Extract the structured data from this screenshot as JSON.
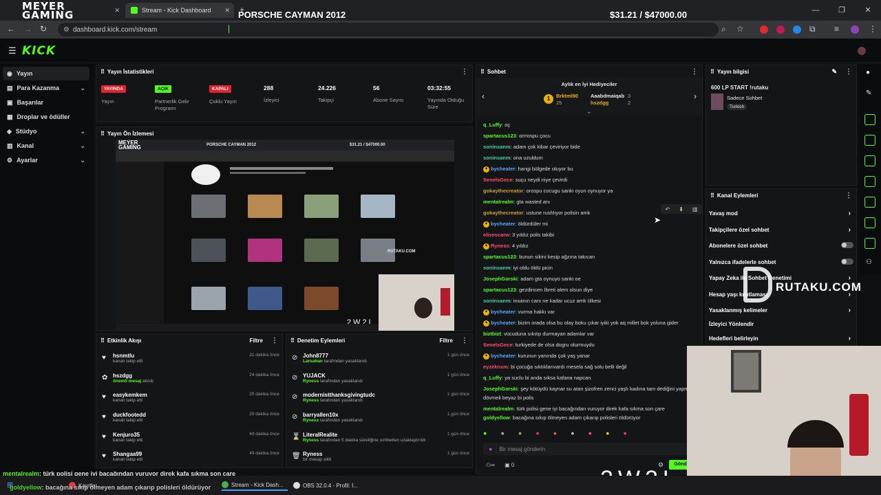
{
  "browser": {
    "tab1_label": "Meyer Gaming",
    "tab2_label": "Stream - Kick Dashboard",
    "url": "dashboard.kick.com/stream",
    "overlay_brand_line1": "MEYER",
    "overlay_brand_line2": "GAMING",
    "overlay_game": "PORSCHE CAYMAN 2012",
    "overlay_money": "$31.21 / $47000.00"
  },
  "kick": {
    "logo": "KICK"
  },
  "sidebar": {
    "items": [
      {
        "label": "Yayın"
      },
      {
        "label": "Para Kazanma"
      },
      {
        "label": "Başarılar"
      },
      {
        "label": "Droplar ve ödüller"
      },
      {
        "label": "Stüdyo"
      },
      {
        "label": "Kanal"
      },
      {
        "label": "Ayarlar"
      }
    ]
  },
  "stats": {
    "title": "Yayın İstatistikleri",
    "items": [
      {
        "badge": "YAYINDA",
        "label": "Yayın",
        "color": "#e5232f"
      },
      {
        "badge": "AÇIK",
        "label": "Partnerlik Gelir Programı",
        "color": "#53fc18"
      },
      {
        "badge": "KAPALI",
        "label": "Çoklu Yayın",
        "color": "#e5232f"
      },
      {
        "value": "288",
        "label": "İzleyici"
      },
      {
        "value": "24.226",
        "label": "Takipçi"
      },
      {
        "value": "56",
        "label": "Abone Sayısı"
      },
      {
        "value": "03:32:55",
        "label": "Yayında Olduğu Süre"
      }
    ]
  },
  "preview": {
    "title": "Yayın Ön İzlemesi",
    "inner_brand_1": "MEYER",
    "inner_brand_2": "GAMING",
    "inner_game": "PORSCHE CAYMAN 2012",
    "inner_money": "$31.21 / $47000.00",
    "watermark": "RUTAKU.COM",
    "code": "2W2L"
  },
  "activity": {
    "title": "Etkinlik Akışı",
    "filter": "Filtre",
    "items": [
      {
        "name": "hsnmtlu",
        "sub": "kanalı takip etti",
        "time": "21 dakika önce"
      },
      {
        "name": "hszdgg",
        "sub": "önemli mesaj",
        "sub2": "alındı",
        "time": "24 dakika önce"
      },
      {
        "name": "easykemkem",
        "sub": "kanalı takip etti",
        "time": "25 dakika önce"
      },
      {
        "name": "duckfootedd",
        "sub": "kanalı takip etti",
        "time": "29 dakika önce"
      },
      {
        "name": "Kenjuro35",
        "sub": "kanalı takip etti",
        "time": "49 dakika önce"
      },
      {
        "name": "Shangaa99",
        "sub": "kanalı takip etti",
        "time": "49 dakika önce"
      }
    ]
  },
  "moderation": {
    "title": "Denetim Eylemleri",
    "filter": "Filtre",
    "items": [
      {
        "name": "John8777",
        "by": "Larsahan",
        "sub": "tarafından yasaklandı",
        "time": "1 gün önce"
      },
      {
        "name": "YUJACK",
        "by": "Ryness",
        "sub": "tarafından yasaklandı",
        "time": "1 gün önce"
      },
      {
        "name": "modernistthanksgivingtudc",
        "by": "Ryness",
        "sub": "tarafından yasaklandı",
        "time": "1 gün önce"
      },
      {
        "name": "barryallen10x",
        "by": "Ryness",
        "sub": "tarafından yasaklandı",
        "time": "1 gün önce"
      },
      {
        "name": "LiteralRealite",
        "by": "Ryness",
        "sub": "tarafından 5 dakika süreliğine sohbetten uzaklaştırıldı",
        "time": "1 gün önce"
      },
      {
        "name": "Ryness",
        "by": "",
        "sub": "bir mesajı sildi",
        "time": "1 gün önce"
      }
    ]
  },
  "chat": {
    "title": "Sohbet",
    "gifters_title": "Aylık en İyi Hediyeciler",
    "gifters": [
      {
        "name": "Brktml90",
        "count": "25"
      },
      {
        "name": "Aaabdmaiqab",
        "count": "3"
      },
      {
        "name": "hszdgg",
        "count": "2"
      }
    ],
    "messages": [
      {
        "user": "q_Luffy",
        "text": ": oç",
        "color": "#53fc18"
      },
      {
        "user": "spartacus123",
        "text": ": orrrospu çocu",
        "color": "#53fc18"
      },
      {
        "user": "soninsanm",
        "text": ": adam çok kibar çeviriyor bide",
        "color": "#3fd0a0"
      },
      {
        "user": "soninsanm",
        "text": ": ona uzuldum",
        "color": "#3fd0a0"
      },
      {
        "user": "bycheater",
        "text": ": hangi bölgede oluyor bu",
        "color": "#58a6ff",
        "icon": true
      },
      {
        "user": "SenelsGece",
        "text": ": suçu neydi niye çevirdi",
        "color": "#ff4d6d"
      },
      {
        "user": "gokaythecreator",
        "text": ": orospu cocugu sanki oyun oynuyor ya",
        "color": "#c9a227"
      },
      {
        "user": "mentalrealm",
        "text": ": gta wasted anı",
        "color": "#53fc18"
      },
      {
        "user": "gokaythecreator",
        "text": ": ustune rushlıyor polisin amk",
        "color": "#c9a227"
      },
      {
        "user": "bycheater",
        "text": ": öldürdüler mi",
        "color": "#58a6ff",
        "icon": true
      },
      {
        "user": "elisescarw",
        "text": ": 3 yıldız polis takibi",
        "color": "#ff4d6d"
      },
      {
        "user": "Ryness",
        "text": ": 4 yıldız",
        "color": "#ff4d6d",
        "icon": true
      },
      {
        "user": "spartacus123",
        "text": ": bunun sikini kesip ağzına takıcan",
        "color": "#53fc18"
      },
      {
        "user": "soninsanm",
        "text": ": iyi oldu öldü picin",
        "color": "#3fd0a0"
      },
      {
        "user": "JosephGorski",
        "text": ": adam gta oynuyo sanki oe",
        "color": "#53fc18"
      },
      {
        "user": "spartacus123",
        "text": ": gezdiricen İbreti alem olsun diye",
        "color": "#53fc18"
      },
      {
        "user": "soninsanm",
        "text": ": insanın canı ne kadar ucuz amk ülkesi",
        "color": "#3fd0a0"
      },
      {
        "user": "bycheater",
        "text": ": vurma hakkı var",
        "color": "#58a6ff",
        "icon": true
      },
      {
        "user": "bycheater",
        "text": ": bizim orada olsa bu olay boku çıkar iyiki yok aq millet bok yoluna gider",
        "color": "#58a6ff",
        "icon": true
      },
      {
        "user": "biztbizt",
        "text": ": vücuduna sıkılıp durmayan adamlar var",
        "color": "#53fc18"
      },
      {
        "user": "SenelsGece",
        "text": ": turkiyede de olsa dogru olurmuydu",
        "color": "#ff4d6d"
      },
      {
        "user": "bycheater",
        "text": ": kurunun yanında çok yaş yanar",
        "color": "#58a6ff",
        "icon": true
      },
      {
        "user": "eyzeknxm",
        "text": ": bi çocuğa sıktıklarıvardı mesela sağ solu belli değil",
        "color": "#ff4d6d"
      },
      {
        "user": "q_Luffy",
        "text": ": ya suclu bi anda sıksa kafana napcan",
        "color": "#53fc18"
      },
      {
        "user": "JosephGorski",
        "text": ": şey kötüydü kaynar su atan şizofren zenci yaşlı kadına tam dediğini yapmış",
        "color": "#53fc18"
      },
      {
        "user": "",
        "text": "dövmeli beyaz bi polis",
        "color": "#53fc18"
      },
      {
        "user": "mentalrealm",
        "text": ": türk polisi gene iyi bacağından vuruyor direk kafa sıkma son çare",
        "color": "#53fc18"
      },
      {
        "user": "goldyellow",
        "text": ": bacağına sıkıp ölmeyen adam çıkarıp polisleri öldürüyor",
        "color": "#53fc18"
      }
    ],
    "input_placeholder": "Bir mesaj gönderin",
    "send_label": "Gönder",
    "count_zero": "0"
  },
  "stream_info": {
    "title": "Yayın bilgisi",
    "stream_title": "600 LP START !rutaku",
    "chat_mode": "Sadece Sohbet",
    "language": "Turkish"
  },
  "channel_actions": {
    "title": "Kanal Eylemleri",
    "items": [
      {
        "label": "Yavaş mod",
        "control": "chevron"
      },
      {
        "label": "Takipçilere özel sohbet",
        "control": "chevron"
      },
      {
        "label": "Abonelere özel sohbet",
        "control": "toggle"
      },
      {
        "label": "Yalnızca ifadelerle sohbet",
        "control": "toggle"
      },
      {
        "label": "Yapay Zeka ile Sohbet Denetimi",
        "control": "chevron"
      },
      {
        "label": "Hesap yaşı kısıtlaması",
        "control": "chevron"
      },
      {
        "label": "Yasaklanmış kelimeler",
        "control": "chevron"
      },
      {
        "label": "İzleyici Yönlendir",
        "control": "none"
      },
      {
        "label": "Hedefleri belirleyin",
        "control": "chevron"
      }
    ]
  },
  "overlay": {
    "ticker1_user": "mentalrealm",
    "ticker1_text": ": türk polisi gene iyi bacağından vuruyor direk kafa sıkma son çare",
    "ticker2_user": "goldyellow",
    "ticker2_text": ": bacağına sıkıp ölmeyen adam çıkarıp polisleri öldürüyor",
    "watermark": "RUTAKU.COM",
    "code": "2W2L"
  },
  "taskbar": {
    "items": [
      {
        "label": "Kayıtlar"
      },
      {
        "label": "Stream - Kick Dash..."
      },
      {
        "label": "OBS 32.0.4 - Profil: İ..."
      }
    ]
  }
}
